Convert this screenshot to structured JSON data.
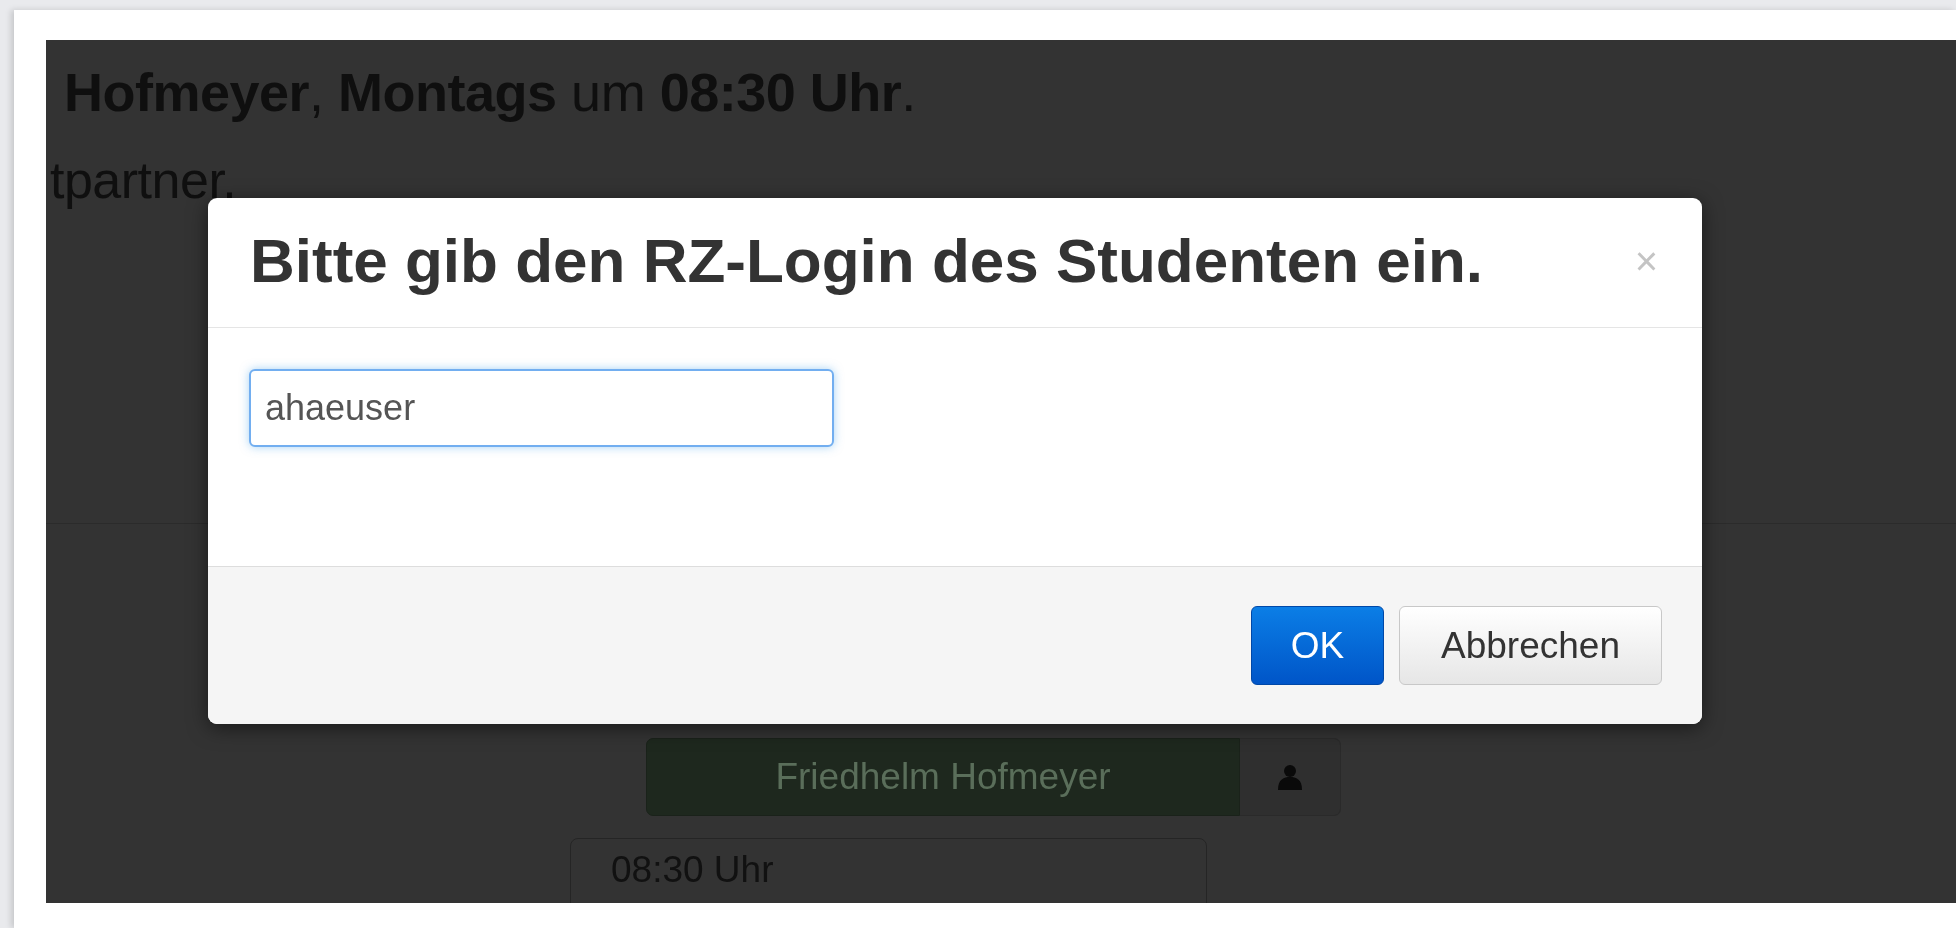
{
  "background": {
    "lines": [
      "**Hofmeyer**, **Montags** um **08:30 Uhr**.",
      "tpartner."
    ],
    "person_button": {
      "label": "Friedhelm Hofmeyer"
    },
    "time_card": {
      "label": "08:30 Uhr"
    }
  },
  "dialog": {
    "title": "Bitte gib den RZ-Login des Studenten ein.",
    "close": "×",
    "login_field": {
      "value": "ahaeuser",
      "focused": true
    },
    "buttons": [
      {
        "label": "OK",
        "kind": "primary"
      },
      {
        "label": "Abbrechen",
        "kind": "default"
      }
    ]
  }
}
